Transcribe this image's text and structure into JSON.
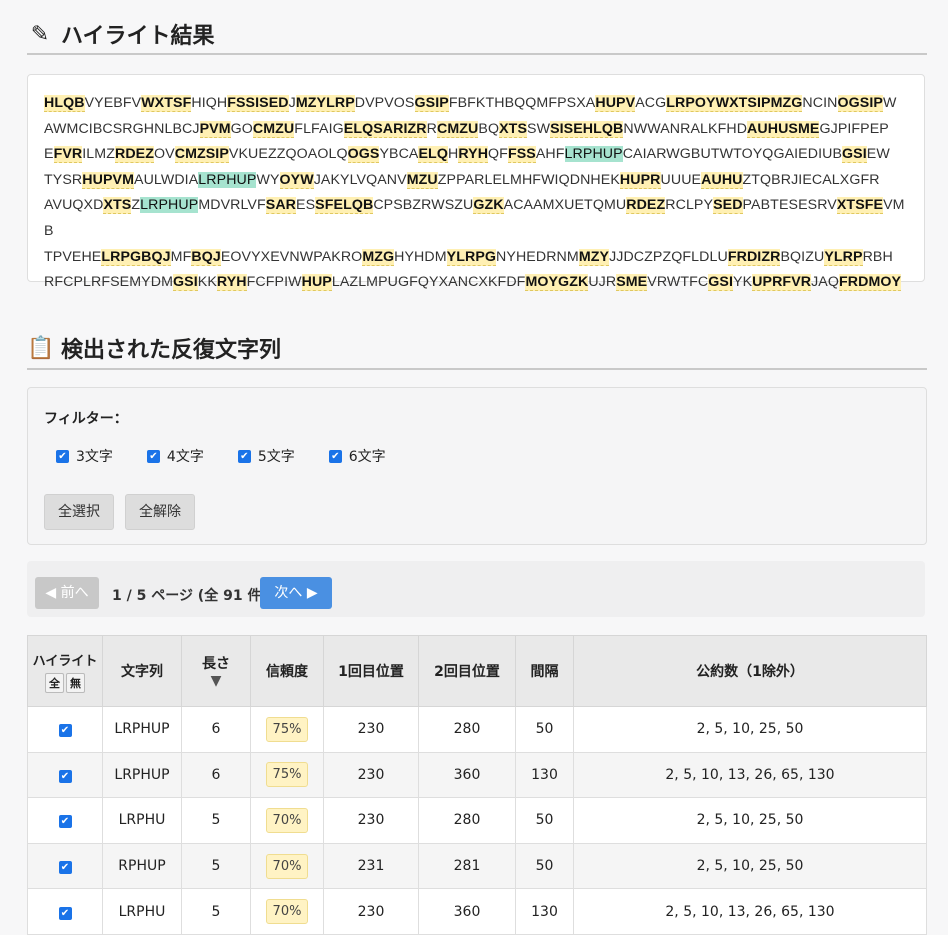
{
  "headings": {
    "highlight_title": "ハイライト結果",
    "repeats_title": "検出された反復文字列"
  },
  "highlight_lines": [
    [
      [
        "HLQB",
        1
      ],
      [
        "VYEBFV",
        0
      ],
      [
        "WXTSF",
        1
      ],
      [
        "HIQH",
        0
      ],
      [
        "FSSISED",
        1
      ],
      [
        "J",
        0
      ],
      [
        "MZYLRP",
        1
      ],
      [
        "DVPVOS",
        0
      ],
      [
        "GSIP",
        1
      ],
      [
        "FBFKTHBQQMFPSXA",
        0
      ],
      [
        "HUPV",
        1
      ],
      [
        "ACG",
        0
      ],
      [
        "LRPOYWXTSIPMZG",
        1
      ],
      [
        "NCIN",
        0
      ],
      [
        "OGSIP",
        1
      ],
      [
        "W",
        0
      ]
    ],
    [
      [
        "AWMCIBCSRGHNLBCJ",
        0
      ],
      [
        "PVM",
        1
      ],
      [
        "GO",
        0
      ],
      [
        "CMZU",
        1
      ],
      [
        "FLFAIG",
        0
      ],
      [
        "ELQSARIZR",
        1
      ],
      [
        "R",
        0
      ],
      [
        "CMZU",
        1
      ],
      [
        "BQ",
        0
      ],
      [
        "XTS",
        1
      ],
      [
        "SW",
        0
      ],
      [
        "SISEHLQB",
        1
      ],
      [
        "NWWANRALKFHD",
        0
      ],
      [
        "AUHUSME",
        1
      ],
      [
        "GJPIFPEP",
        0
      ]
    ],
    [
      [
        "E",
        0
      ],
      [
        "FVR",
        1
      ],
      [
        "ILMZ",
        0
      ],
      [
        "RDEZ",
        1
      ],
      [
        "OV",
        0
      ],
      [
        "CMZSIP",
        1
      ],
      [
        "VKUEZZQOAOLQ",
        0
      ],
      [
        "OGS",
        1
      ],
      [
        "YBCA",
        0
      ],
      [
        "ELQ",
        1
      ],
      [
        "H",
        0
      ],
      [
        "RYH",
        1
      ],
      [
        "QF",
        0
      ],
      [
        "FSS",
        1
      ],
      [
        "AHF",
        0
      ],
      [
        "LRPHUP",
        2
      ],
      [
        "CAIARWGBUTWTOYQGAIEDIUB",
        0
      ],
      [
        "GSI",
        1
      ],
      [
        "EW",
        0
      ]
    ],
    [
      [
        "TYSR",
        0
      ],
      [
        "HUPVM",
        1
      ],
      [
        "AULWDIA",
        0
      ],
      [
        "LRPHUP",
        2
      ],
      [
        "WY",
        0
      ],
      [
        "OYW",
        1
      ],
      [
        "JAKYLVQANV",
        0
      ],
      [
        "MZU",
        1
      ],
      [
        "ZPPARLELMHFWIQDNHEK",
        0
      ],
      [
        "HUPR",
        1
      ],
      [
        "UUUE",
        0
      ],
      [
        "AUHU",
        1
      ],
      [
        "ZTQBRJIECALXGFR",
        0
      ]
    ],
    [
      [
        "AVUQXD",
        0
      ],
      [
        "XTS",
        1
      ],
      [
        "Z",
        0
      ],
      [
        "LRPHUP",
        2
      ],
      [
        "MDVRLVF",
        0
      ],
      [
        "SAR",
        1
      ],
      [
        "ES",
        0
      ],
      [
        "SFELQB",
        1
      ],
      [
        "CPSBZRWSZU",
        0
      ],
      [
        "GZK",
        1
      ],
      [
        "ACAAMXUETQMU",
        0
      ],
      [
        "RDEZ",
        1
      ],
      [
        "RCLPY",
        0
      ],
      [
        "SED",
        1
      ],
      [
        "PABTESESRV",
        0
      ],
      [
        "XTSFE",
        1
      ],
      [
        "VMB",
        0
      ]
    ],
    [
      [
        "TPVEHE",
        0
      ],
      [
        "LRPGBQJ",
        1
      ],
      [
        "MF",
        0
      ],
      [
        "BQJ",
        1
      ],
      [
        "EOVYXEVNWPAKRO",
        0
      ],
      [
        "MZG",
        1
      ],
      [
        "HYHDM",
        0
      ],
      [
        "YLRPG",
        1
      ],
      [
        "NYHEDRNM",
        0
      ],
      [
        "MZY",
        1
      ],
      [
        "JJDCZPZQFLDLU",
        0
      ],
      [
        "FRDIZR",
        1
      ],
      [
        "BQIZU",
        0
      ],
      [
        "YLRP",
        1
      ],
      [
        "RBH",
        0
      ]
    ],
    [
      [
        "RFCPLRFSEMYDM",
        0
      ],
      [
        "GSI",
        1
      ],
      [
        "KK",
        0
      ],
      [
        "RYH",
        1
      ],
      [
        "FCFPIW",
        0
      ],
      [
        "HUP",
        1
      ],
      [
        "LAZLMPUGFQYXANCXKFDF",
        0
      ],
      [
        "MOYGZK",
        1
      ],
      [
        "UJR",
        0
      ],
      [
        "SME",
        1
      ],
      [
        "VRWTFC",
        0
      ],
      [
        "GSI",
        1
      ],
      [
        "YK",
        0
      ],
      [
        "UPRFVR",
        1
      ],
      [
        "JAQ",
        0
      ],
      [
        "FRDMOY",
        1
      ]
    ]
  ],
  "filter": {
    "title": "フィルター：",
    "options": [
      "3文字",
      "4文字",
      "5文字",
      "6文字"
    ],
    "select_all": "全選択",
    "clear_all": "全解除"
  },
  "pager": {
    "prev": "◀ 前へ",
    "info": "1 / 5 ページ (全 91 件)",
    "next": "次へ ▶"
  },
  "table": {
    "headers": {
      "highlight": "ハイライト",
      "all_btn": "全",
      "none_btn": "無",
      "string": "文字列",
      "length": "長さ",
      "sort_arrow": "▼",
      "confidence": "信頼度",
      "pos1": "1回目位置",
      "pos2": "2回目位置",
      "interval": "間隔",
      "divisors": "公約数（1除外）"
    },
    "rows": [
      {
        "checked": true,
        "string": "LRPHUP",
        "length": "6",
        "confidence": "75%",
        "pos1": "230",
        "pos2": "280",
        "interval": "50",
        "divisors": "2, 5, 10, 25, 50"
      },
      {
        "checked": true,
        "string": "LRPHUP",
        "length": "6",
        "confidence": "75%",
        "pos1": "230",
        "pos2": "360",
        "interval": "130",
        "divisors": "2, 5, 10, 13, 26, 65, 130"
      },
      {
        "checked": true,
        "string": "LRPHU",
        "length": "5",
        "confidence": "70%",
        "pos1": "230",
        "pos2": "280",
        "interval": "50",
        "divisors": "2, 5, 10, 25, 50"
      },
      {
        "checked": true,
        "string": "RPHUP",
        "length": "5",
        "confidence": "70%",
        "pos1": "231",
        "pos2": "281",
        "interval": "50",
        "divisors": "2, 5, 10, 25, 50"
      },
      {
        "checked": true,
        "string": "LRPHU",
        "length": "5",
        "confidence": "70%",
        "pos1": "230",
        "pos2": "360",
        "interval": "130",
        "divisors": "2, 5, 10, 13, 26, 65, 130"
      }
    ]
  }
}
